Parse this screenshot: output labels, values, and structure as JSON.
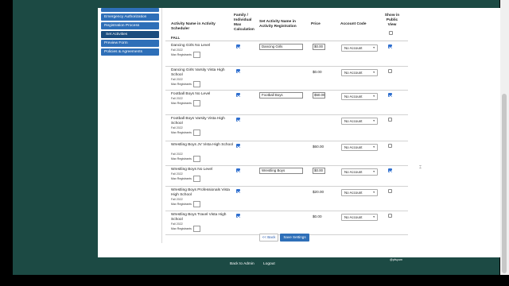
{
  "sidebar": {
    "items": [
      {
        "label": "Emergency Authorization"
      },
      {
        "label": "Registration Process"
      },
      {
        "label": "Set Activities"
      },
      {
        "label": "Preview Form"
      },
      {
        "label": "Policies & Agreements"
      }
    ]
  },
  "table": {
    "headers": {
      "activity_name": "Activity Name in Activity Scheduler",
      "family_individual": "Family / Individual Max Calculation",
      "registration_name": "Set Activity Name in Activity Registration",
      "price": "Price",
      "account_code": "Account Code",
      "show_public": "Show in Public View"
    },
    "season_label": "FALL",
    "max_label": "Max Registrants",
    "rows": [
      {
        "name": "Dancing Girls No Level",
        "season": "Fall 2022",
        "family_checked": true,
        "registration_name": "Dancing Girls",
        "price": "$0.00",
        "price_editable": true,
        "account": "No Account",
        "public_checked": true
      },
      {
        "name": "Dancing Girls Varsity Vista High School",
        "season": "Fall 2022",
        "family_checked": true,
        "registration_name": "",
        "price": "$0.00",
        "price_editable": false,
        "account": "No Account",
        "public_checked": false
      },
      {
        "name": "Football Boys No Level",
        "season": "Fall 2022",
        "family_checked": true,
        "registration_name": "Football Boys",
        "price": "$50.00",
        "price_editable": true,
        "account": "No Account",
        "public_checked": true
      },
      {
        "name": "Football Boys Varsity Vista High School",
        "season": "Fall 2022",
        "family_checked": true,
        "registration_name": "",
        "price": "",
        "price_editable": false,
        "account": "No Account",
        "public_checked": false
      },
      {
        "name": "Wrestling Boys JV Vista High School",
        "season": "Fall 2022",
        "family_checked": true,
        "registration_name": "",
        "price": "$60.00",
        "price_editable": false,
        "account": "No Account",
        "public_checked": false
      },
      {
        "name": "Wrestling Boys No Level",
        "season": "Fall 2022",
        "family_checked": true,
        "registration_name": "Wrestling Boys",
        "price": "$0.00",
        "price_editable": true,
        "account": "No Account",
        "public_checked": true
      },
      {
        "name": "Wrestling Boys Professionals Vista High School",
        "season": "Fall 2022",
        "family_checked": true,
        "registration_name": "",
        "price": "$20.00",
        "price_editable": false,
        "account": "No Account",
        "public_checked": false
      },
      {
        "name": "Wrestling Boys Travel Vista High School",
        "season": "Fall 2022",
        "family_checked": true,
        "registration_name": "",
        "price": "$0.00",
        "price_editable": false,
        "account": "No Account",
        "public_checked": false
      }
    ]
  },
  "actions": {
    "back_label": "<< Back",
    "save_label": "Save Settings"
  },
  "footer": {
    "back_to_admin": "Back to Admin",
    "logout": "Logout",
    "credit": "@pfsyum"
  }
}
